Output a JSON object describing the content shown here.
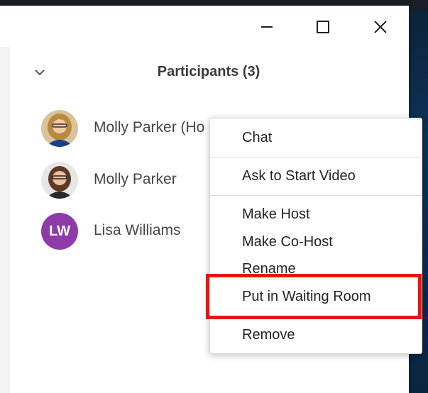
{
  "window": {
    "controls": {
      "minimize_icon": "minimize-icon",
      "maximize_icon": "maximize-icon",
      "close_icon": "close-icon"
    }
  },
  "panel": {
    "title": "Participants (3)",
    "collapse_icon": "chevron-down-icon"
  },
  "participants": [
    {
      "name": "Molly Parker (Ho",
      "avatar": "photo",
      "avatar_color": "#c9a15a"
    },
    {
      "name": "Molly Parker",
      "avatar": "photo",
      "avatar_color": "#6b6b6b"
    },
    {
      "name": "Lisa Williams",
      "avatar": "initials",
      "initials": "LW",
      "avatar_color": "#8e3ba9"
    }
  ],
  "context_menu": {
    "items": [
      "Chat",
      "Ask to Start Video",
      "Make Host",
      "Make Co-Host",
      "Rename",
      "Put in Waiting Room",
      "Remove"
    ],
    "highlighted_item": "Put in Waiting Room",
    "highlight_color": "#e8160f"
  }
}
